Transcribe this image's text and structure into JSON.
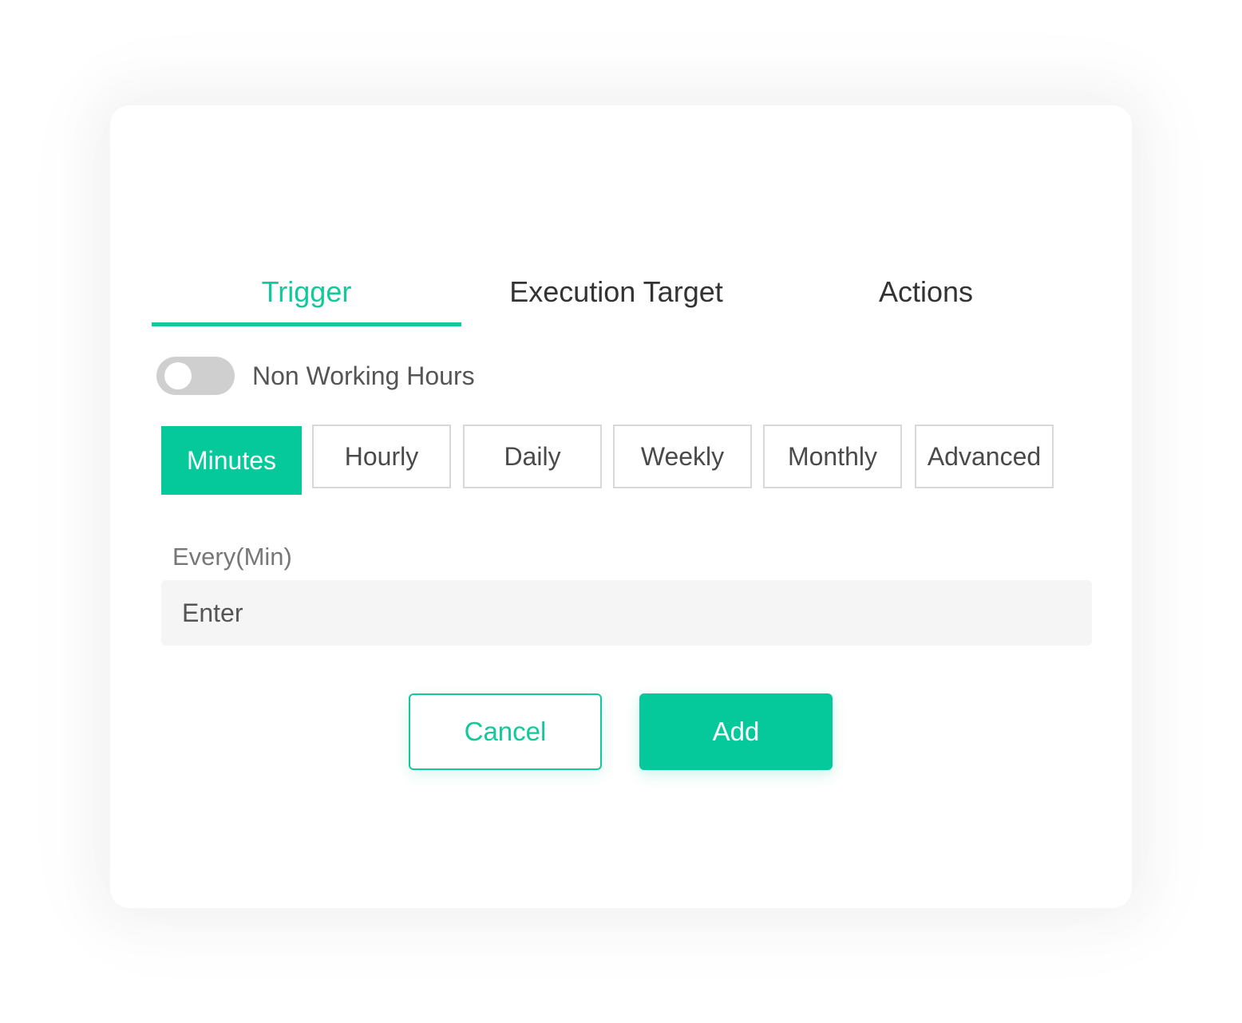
{
  "tabs": [
    {
      "label": "Trigger",
      "active": true
    },
    {
      "label": "Execution Target",
      "active": false
    },
    {
      "label": "Actions",
      "active": false
    }
  ],
  "toggle": {
    "label": "Non Working Hours",
    "on": false
  },
  "frequency": {
    "options": [
      "Minutes",
      "Hourly",
      "Daily",
      "Weekly",
      "Monthly",
      "Advanced"
    ],
    "selected": "Minutes"
  },
  "field": {
    "label": "Every(Min)",
    "placeholder": "Enter",
    "value": ""
  },
  "actions": {
    "cancel_label": "Cancel",
    "add_label": "Add"
  },
  "colors": {
    "accent": "#12c99b",
    "accent_fill": "#05c99b"
  }
}
